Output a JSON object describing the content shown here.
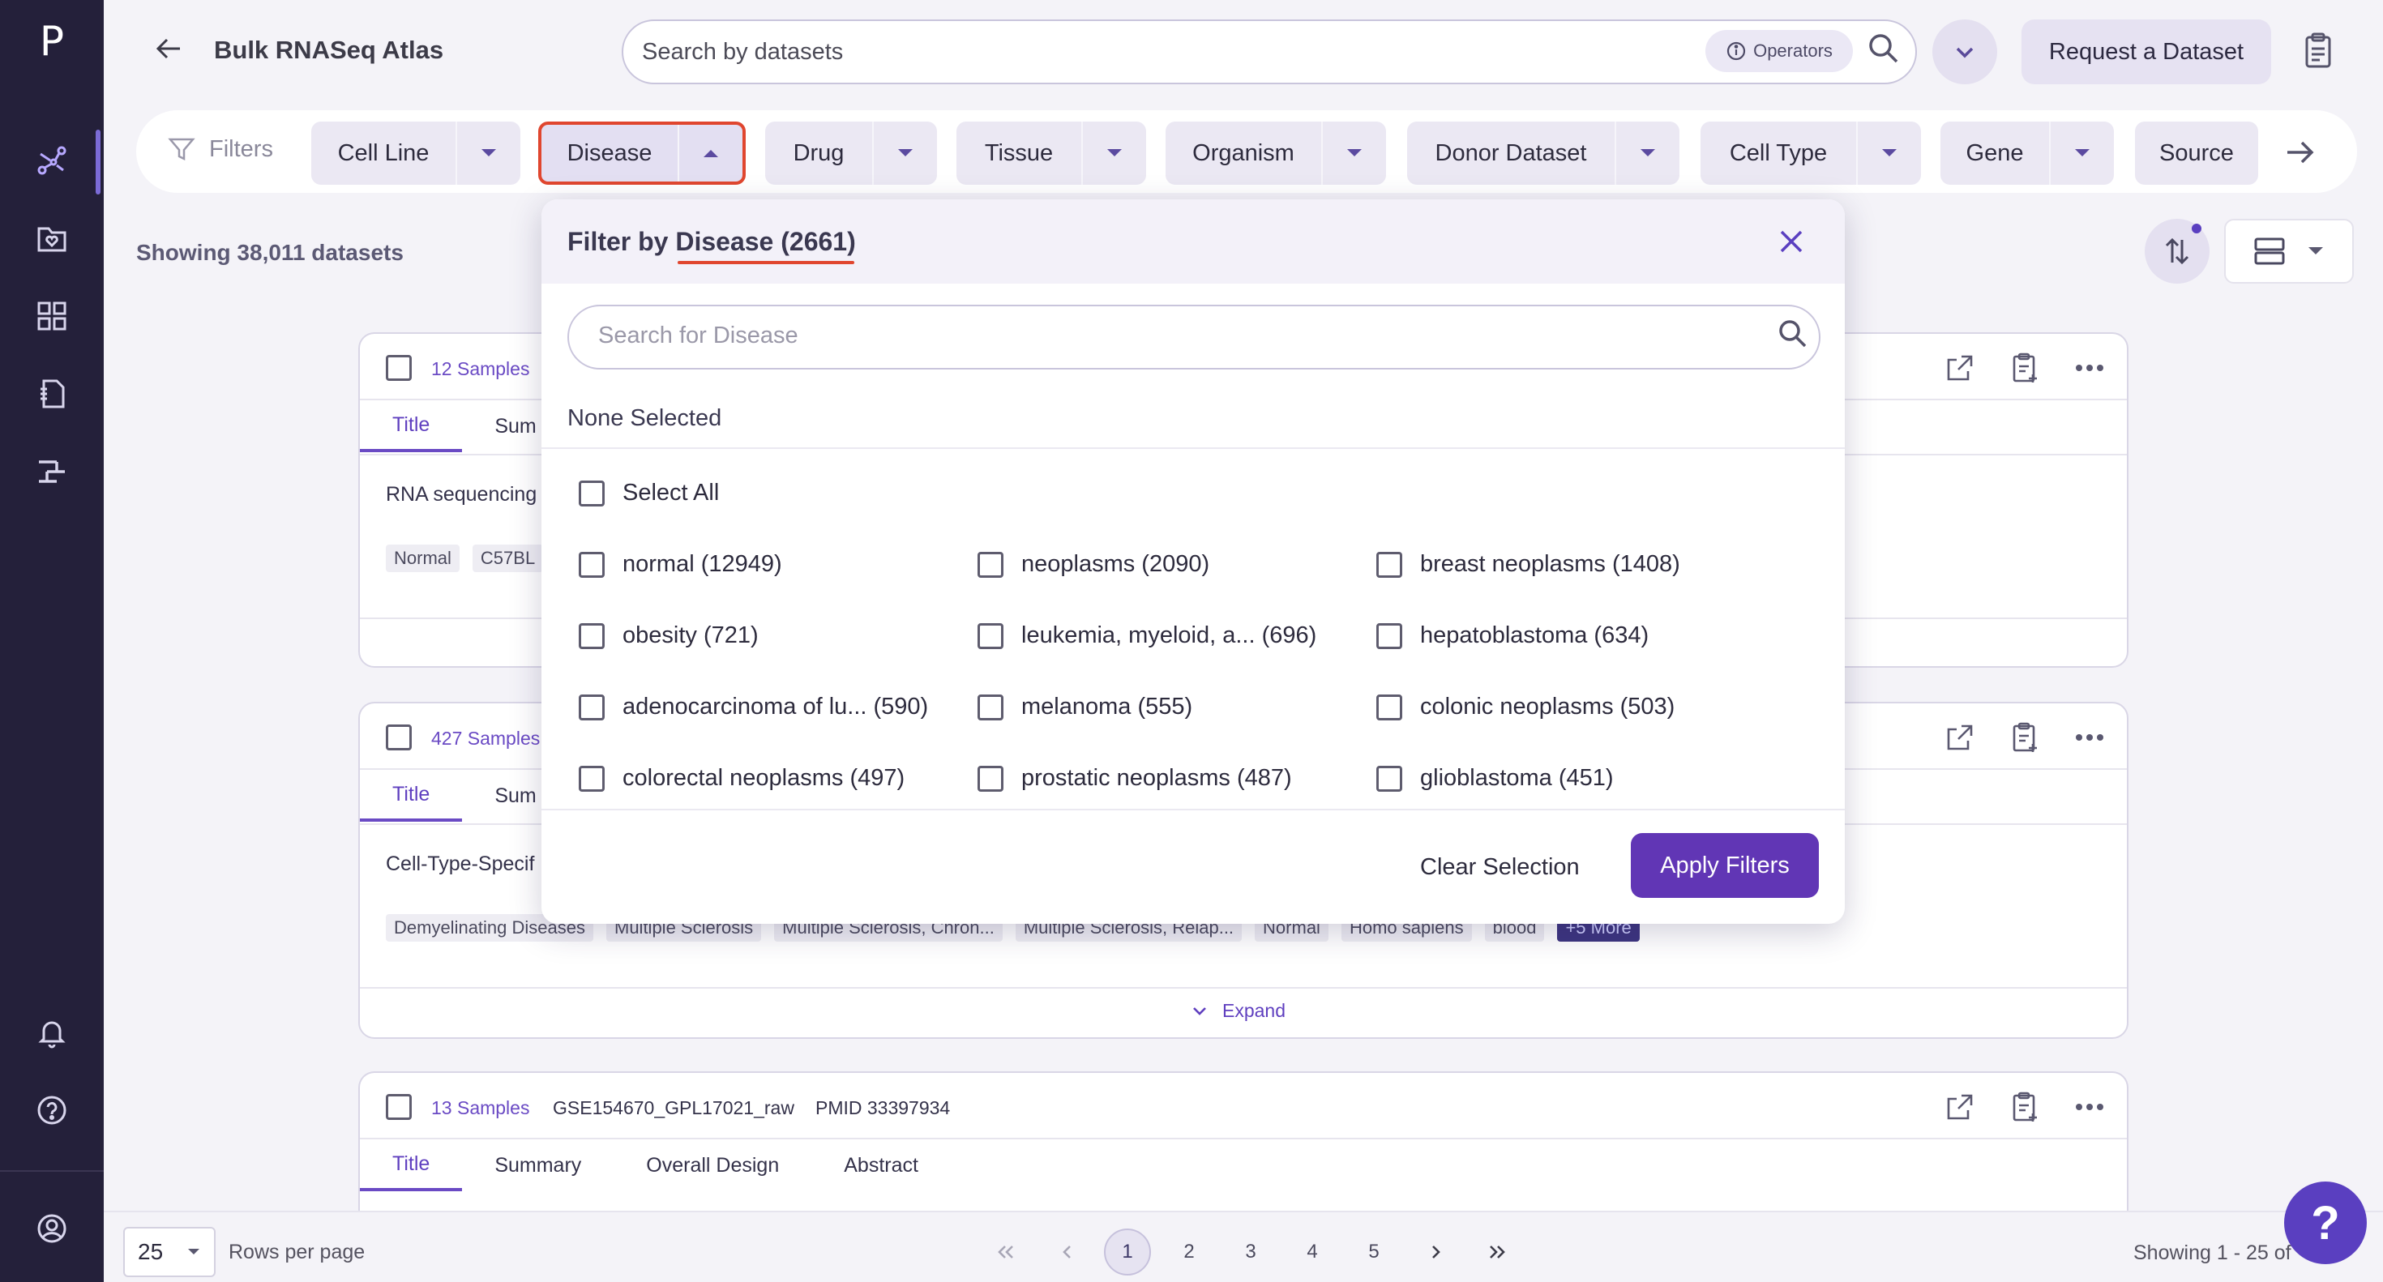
{
  "sidebar": {
    "logo": "P"
  },
  "header": {
    "title": "Bulk RNASeq Atlas",
    "search_placeholder": "Search by datasets",
    "operators_label": "Operators",
    "request_button": "Request a Dataset"
  },
  "filters": {
    "label": "Filters",
    "chips": [
      "Cell Line",
      "Disease",
      "Drug",
      "Tissue",
      "Organism",
      "Donor Dataset",
      "Cell Type",
      "Gene",
      "Source"
    ],
    "active_chip": "Disease"
  },
  "results": {
    "showing_text": "Showing 38,011 datasets"
  },
  "cards": [
    {
      "samples": "12 Samples",
      "tabs": [
        "Title",
        "Sum"
      ],
      "text": "RNA sequencing",
      "tags": [
        "Normal",
        "C57BL"
      ]
    },
    {
      "samples": "427 Samples",
      "tabs": [
        "Title",
        "Sum"
      ],
      "text": "Cell-Type-Specif",
      "tags": [
        "Demyelinating Diseases",
        "Multiple Sclerosis",
        "Multiple Sclerosis, Chron...",
        "Multiple Sclerosis, Relap...",
        "Normal",
        "Homo sapiens",
        "blood",
        "+5 More"
      ],
      "expand_label": "Expand"
    },
    {
      "samples": "13 Samples",
      "dataset_id": "GSE154670_GPL17021_raw",
      "pmid": "PMID 33397934",
      "tabs": [
        "Title",
        "Summary",
        "Overall Design",
        "Abstract"
      ]
    }
  ],
  "popup": {
    "title_prefix": "Filter by ",
    "title_field": "Disease (2661)",
    "search_placeholder": "Search for Disease",
    "selection_status": "None Selected",
    "select_all": "Select All",
    "options": [
      "normal (12949)",
      "neoplasms (2090)",
      "breast neoplasms (1408)",
      "obesity (721)",
      "leukemia, myeloid, a... (696)",
      "hepatoblastoma (634)",
      "adenocarcinoma of lu... (590)",
      "melanoma (555)",
      "colonic neoplasms (503)",
      "colorectal neoplasms (497)",
      "prostatic neoplasms (487)",
      "glioblastoma (451)"
    ],
    "clear_label": "Clear Selection",
    "apply_label": "Apply Filters"
  },
  "pagination": {
    "rows_value": "25",
    "rows_label": "Rows per page",
    "pages": [
      "1",
      "2",
      "3",
      "4",
      "5"
    ],
    "current_page": "1",
    "range_text": "Showing 1 - 25 of"
  },
  "help": {
    "label": "?"
  }
}
